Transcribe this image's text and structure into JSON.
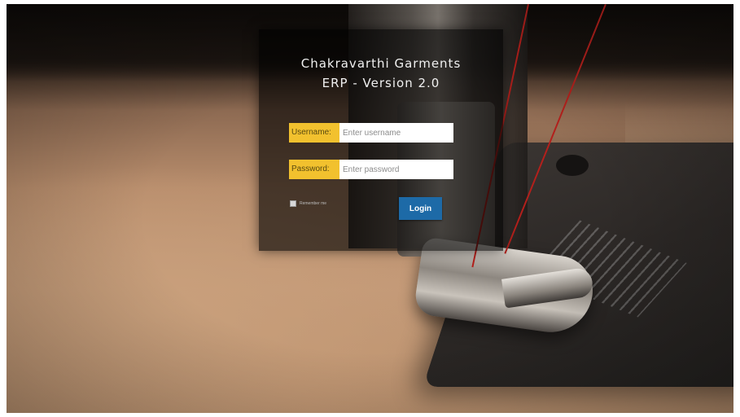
{
  "login": {
    "title_line1": "Chakravarthi Garments",
    "title_line2": "ERP - Version 2.0",
    "username_label": "Username:",
    "username_placeholder": "Enter username",
    "password_label": "Password:",
    "password_placeholder": "Enter password",
    "remember_label": "Remember me",
    "login_button": "Login"
  },
  "colors": {
    "label_bg": "#f2c12e",
    "button_bg": "#1d6aa7",
    "panel_bg": "rgba(0,0,0,0.62)"
  }
}
